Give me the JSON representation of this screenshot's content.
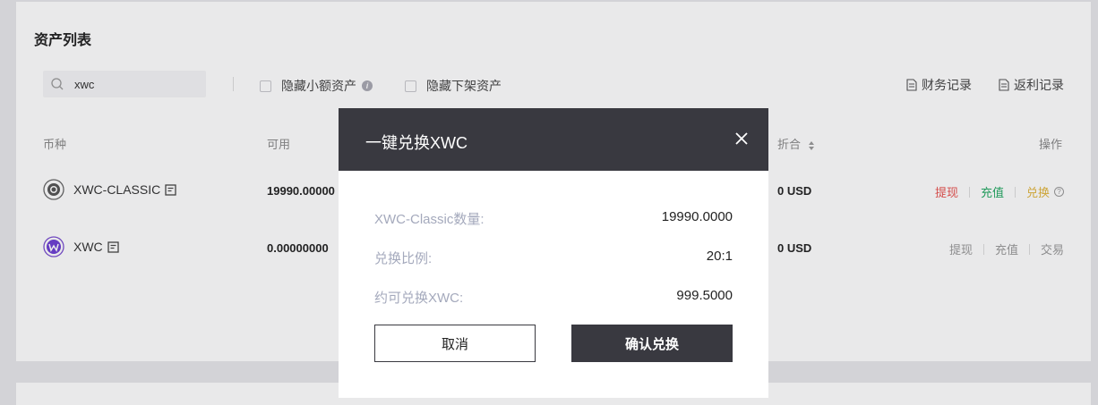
{
  "assets": {
    "title": "资产列表",
    "search": {
      "value": "xwc"
    },
    "filters": {
      "hide_small": "隐藏小额资产",
      "hide_small_info": "i",
      "hide_delisted": "隐藏下架资产"
    },
    "links": {
      "finance_record": "财务记录",
      "rebate_record": "返利记录"
    },
    "columns": {
      "coin": "币种",
      "available": "可用",
      "converted": "折合",
      "actions": "操作"
    },
    "rows": [
      {
        "coin": "XWC-CLASSIC",
        "available": "19990.00000",
        "converted": "0 USD",
        "actions": [
          "提现",
          "充值",
          "兑换"
        ]
      },
      {
        "coin": "XWC",
        "available": "0.00000000",
        "converted": "0 USD",
        "actions": [
          "提现",
          "充值",
          "交易"
        ]
      }
    ],
    "colors": {
      "withdraw": "#e8514d",
      "deposit": "#22a861",
      "exchange": "#e0b43a",
      "muted_action": "#999999"
    }
  },
  "modal": {
    "title": "一键兑换XWC",
    "items": [
      {
        "label": "XWC-Classic数量:",
        "value": "19990.0000"
      },
      {
        "label": "兑换比例:",
        "value": "20:1"
      },
      {
        "label": "约可兑换XWC:",
        "value": "999.5000"
      }
    ],
    "cancel_label": "取消",
    "confirm_label": "确认兑换",
    "colors": {
      "header": "#393940",
      "label": "#a4a9bc"
    }
  }
}
